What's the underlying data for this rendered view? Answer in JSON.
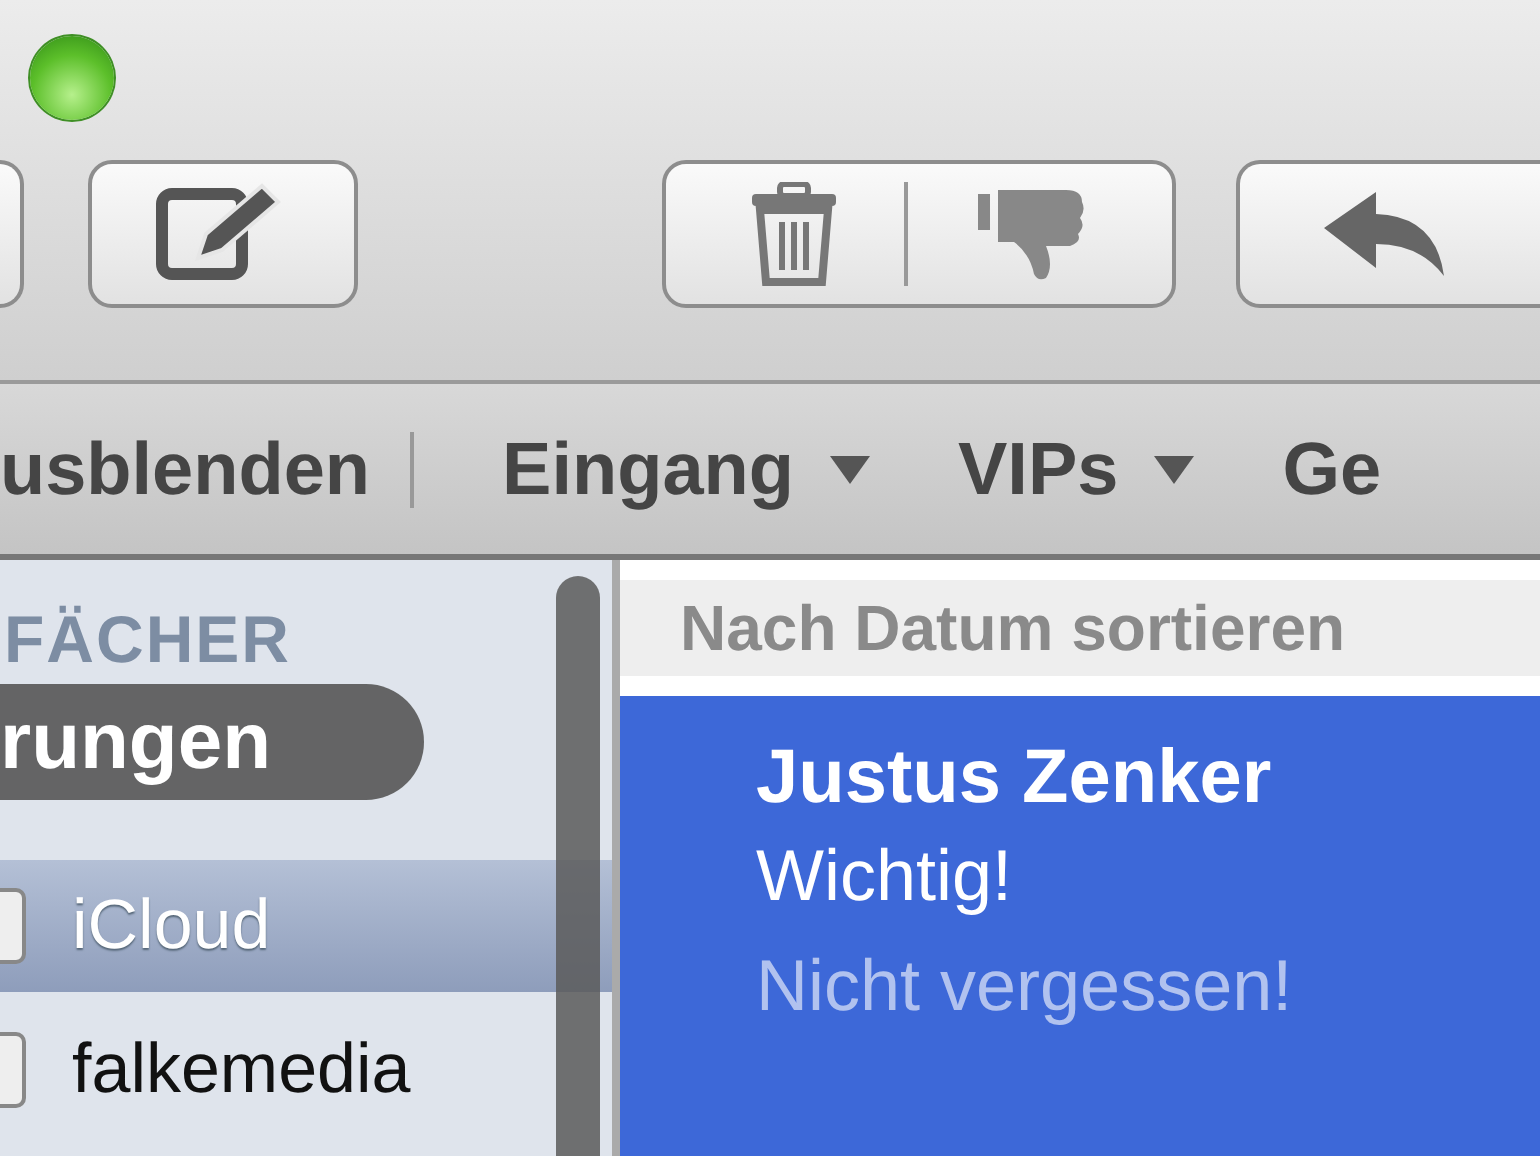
{
  "favorites_bar": {
    "items": [
      {
        "label": "usblenden",
        "kind": "plain"
      },
      {
        "label": "Eingang",
        "kind": "menu"
      },
      {
        "label": "VIPs",
        "kind": "menu"
      },
      {
        "label": "Ge",
        "kind": "plain"
      }
    ]
  },
  "sidebar": {
    "section": "FÄCHER",
    "tooltip": "rungen",
    "items": [
      {
        "label": "iCloud",
        "kind": "account",
        "selected": true
      },
      {
        "label": "falkemedia",
        "kind": "account",
        "selected": false
      }
    ]
  },
  "message_list": {
    "sort_label": "Nach Datum sortieren",
    "messages": [
      {
        "sender": "Justus Zenker",
        "subject": "Wichtig!",
        "preview": "Nicht vergessen!",
        "selected": true
      }
    ]
  }
}
